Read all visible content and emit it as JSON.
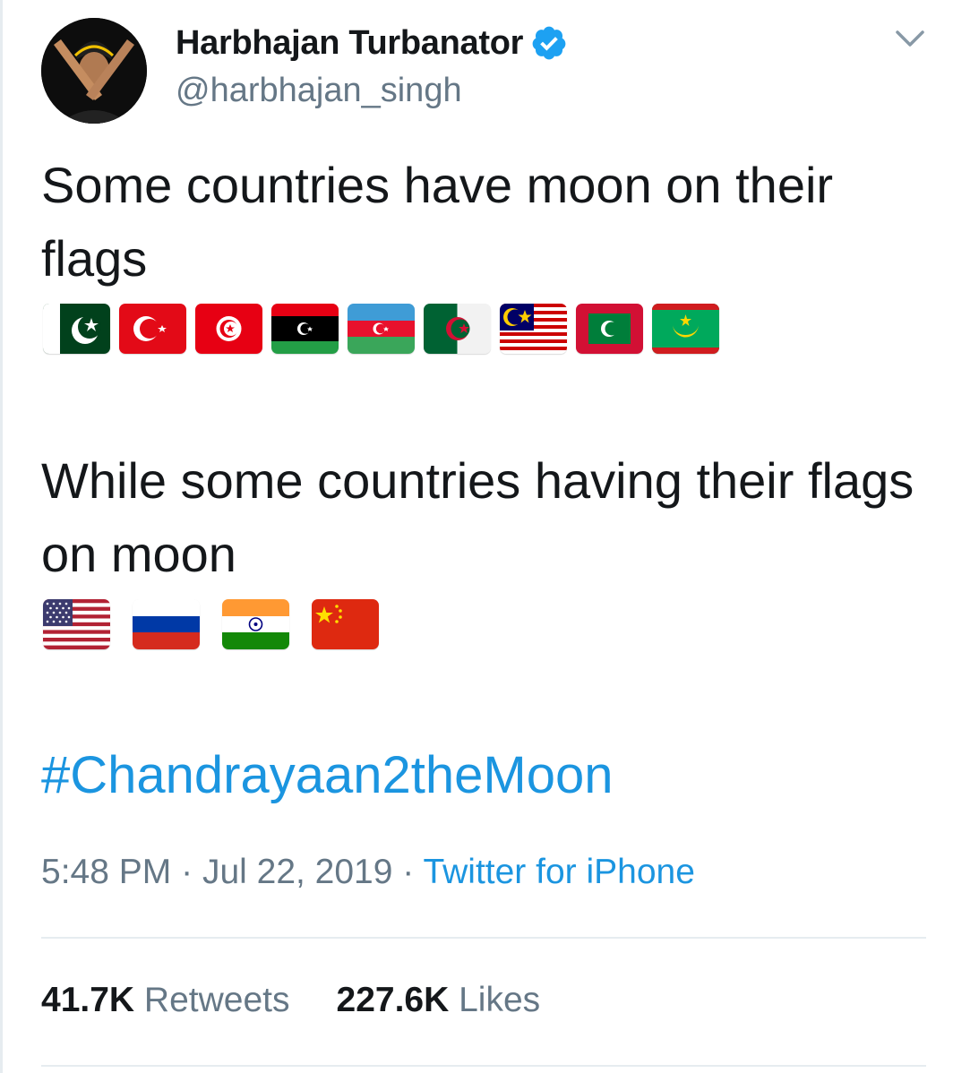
{
  "author": {
    "display_name": "Harbhajan Turbanator",
    "handle": "@harbhajan_singh",
    "verified": true,
    "avatar_icon": "avatar-photo"
  },
  "tweet": {
    "text_part1": "Some countries have moon on their flags",
    "flags_part1": [
      "pakistan-flag",
      "turkey-flag",
      "tunisia-flag",
      "libya-flag",
      "azerbaijan-flag",
      "algeria-flag",
      "malaysia-flag",
      "maldives-flag",
      "mauritania-flag"
    ],
    "text_part2": "While some countries having their flags on moon",
    "flags_part2": [
      "usa-flag",
      "russia-flag",
      "india-flag",
      "china-flag"
    ],
    "hashtag": "#Chandrayaan2theMoon"
  },
  "meta": {
    "time": "5:48 PM",
    "separator": "·",
    "date": "Jul 22, 2019",
    "source": "Twitter for iPhone"
  },
  "stats": {
    "retweets_count": "41.7K",
    "retweets_label": "Retweets",
    "likes_count": "227.6K",
    "likes_label": "Likes"
  },
  "colors": {
    "link": "#1b95e0",
    "secondary_text": "#657786",
    "primary_text": "#14171a",
    "divider": "#e6ecf0"
  }
}
